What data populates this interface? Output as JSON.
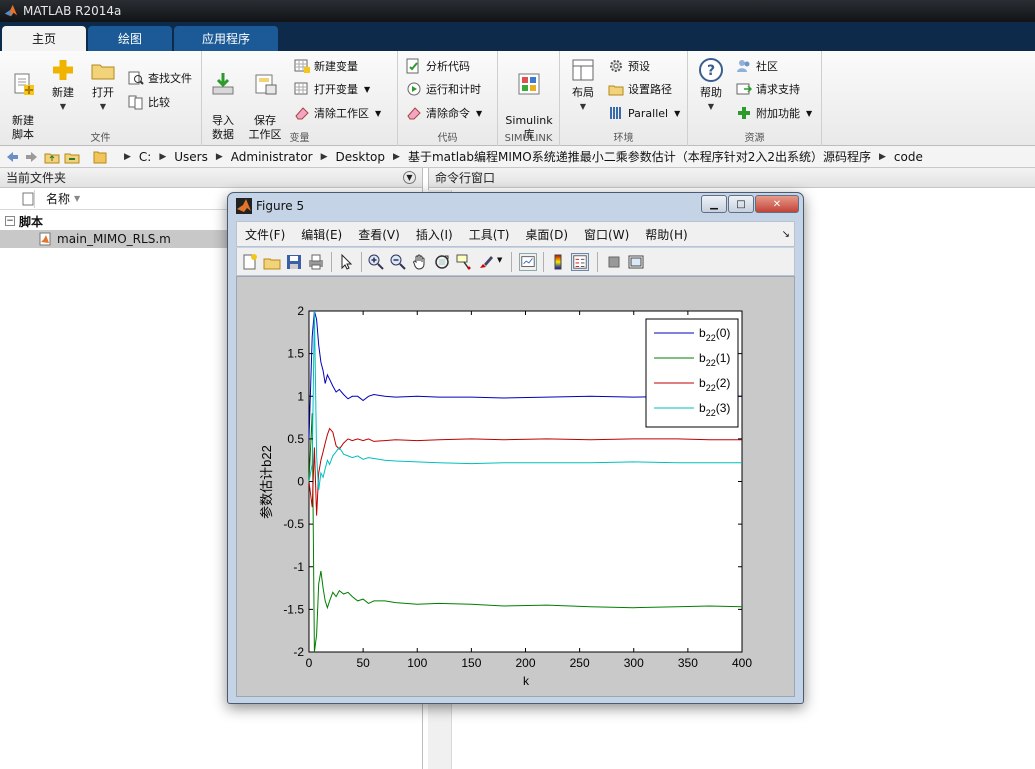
{
  "window": {
    "title": "MATLAB R2014a"
  },
  "tabs": [
    {
      "label": "主页",
      "active": true
    },
    {
      "label": "绘图",
      "active": false
    },
    {
      "label": "应用程序",
      "active": false
    }
  ],
  "ribbon": {
    "file": {
      "label": "文件",
      "new_script": "新建\n脚本",
      "new": "新建",
      "open": "打开",
      "find_files": "查找文件",
      "compare": "比较"
    },
    "variable": {
      "label": "变量",
      "import": "导入\n数据",
      "save_workspace": "保存\n工作区",
      "new_variable": "新建变量",
      "open_variable": "打开变量",
      "clear_workspace": "清除工作区"
    },
    "code": {
      "label": "代码",
      "analyze": "分析代码",
      "run_time": "运行和计时",
      "clear_commands": "清除命令"
    },
    "simulink": {
      "label": "SIMULINK",
      "library": "Simulink\n库"
    },
    "environment": {
      "label": "环境",
      "layout": "布局",
      "preferences": "预设",
      "set_path": "设置路径",
      "parallel": "Parallel"
    },
    "resources": {
      "label": "资源",
      "help": "帮助",
      "community": "社区",
      "request_support": "请求支持",
      "addons": "附加功能"
    }
  },
  "address": {
    "crumbs": [
      "C:",
      "Users",
      "Administrator",
      "Desktop",
      "基于matlab编程MIMO系统递推最小二乘参数估计（本程序针对2入2出系统）源码程序",
      "code"
    ]
  },
  "current_folder": {
    "title": "当前文件夹",
    "column_name": "名称",
    "group": "脚本",
    "files": [
      "main_MIMO_RLS.m"
    ]
  },
  "command_window": {
    "title": "命令行窗口"
  },
  "figure": {
    "title": "Figure 5",
    "menus": [
      "文件(F)",
      "编辑(E)",
      "查看(V)",
      "插入(I)",
      "工具(T)",
      "桌面(D)",
      "窗口(W)",
      "帮助(H)"
    ]
  },
  "chart_data": {
    "type": "line",
    "xlabel": "k",
    "ylabel": "参数估计b22",
    "xlim": [
      0,
      400
    ],
    "ylim": [
      -2,
      2
    ],
    "xticks": [
      0,
      50,
      100,
      150,
      200,
      250,
      300,
      350,
      400
    ],
    "yticks": [
      -2,
      -1.5,
      -1,
      -0.5,
      0,
      0.5,
      1,
      1.5,
      2
    ],
    "yticklabels": [
      "-2",
      "-1.5",
      "-1",
      "-0.5",
      "0",
      "0.5",
      "1",
      "1.5",
      "2"
    ],
    "legend_position": "top-right",
    "series": [
      {
        "name": "b22(0)",
        "label_main": "b",
        "label_sub": "22",
        "label_arg": "(0)",
        "color": "#0000bf",
        "x": [
          0,
          3,
          5,
          7,
          9,
          11,
          13,
          15,
          17,
          19,
          22,
          25,
          28,
          32,
          36,
          40,
          45,
          50,
          55,
          60,
          70,
          80,
          100,
          120,
          150,
          180,
          220,
          260,
          300,
          340,
          370,
          400
        ],
        "y": [
          0.5,
          1.7,
          2.0,
          1.9,
          1.6,
          1.4,
          1.3,
          1.15,
          1.25,
          1.2,
          1.12,
          1.05,
          1.08,
          1.02,
          0.97,
          1.0,
          1.0,
          0.95,
          1.0,
          1.02,
          1.0,
          0.99,
          1.0,
          0.99,
          0.99,
          0.98,
          0.99,
          1.0,
          0.99,
          1.0,
          1.0,
          1.0
        ]
      },
      {
        "name": "b22(1)",
        "label_main": "b",
        "label_sub": "22",
        "label_arg": "(1)",
        "color": "#007f00",
        "x": [
          0,
          3,
          5,
          7,
          9,
          11,
          13,
          15,
          17,
          19,
          22,
          25,
          28,
          32,
          36,
          40,
          45,
          50,
          55,
          60,
          70,
          80,
          100,
          120,
          150,
          180,
          220,
          260,
          300,
          340,
          370,
          400
        ],
        "y": [
          0,
          0.8,
          -2.0,
          -1.8,
          -1.2,
          -1.05,
          -1.25,
          -1.4,
          -1.48,
          -1.4,
          -1.3,
          -1.35,
          -1.28,
          -1.32,
          -1.3,
          -1.35,
          -1.4,
          -1.38,
          -1.43,
          -1.4,
          -1.4,
          -1.42,
          -1.44,
          -1.43,
          -1.44,
          -1.46,
          -1.45,
          -1.47,
          -1.48,
          -1.47,
          -1.46,
          -1.47
        ]
      },
      {
        "name": "b22(2)",
        "label_main": "b",
        "label_sub": "22",
        "label_arg": "(2)",
        "color": "#bf0000",
        "x": [
          0,
          3,
          5,
          7,
          9,
          11,
          13,
          15,
          17,
          19,
          22,
          25,
          28,
          32,
          36,
          40,
          45,
          50,
          55,
          60,
          70,
          80,
          100,
          120,
          150,
          180,
          220,
          260,
          300,
          340,
          370,
          400
        ],
        "y": [
          0,
          -0.3,
          0.4,
          -0.4,
          0.1,
          0.25,
          0.35,
          0.45,
          0.55,
          0.62,
          0.58,
          0.42,
          0.38,
          0.45,
          0.5,
          0.48,
          0.5,
          0.48,
          0.5,
          0.47,
          0.48,
          0.49,
          0.48,
          0.49,
          0.5,
          0.49,
          0.5,
          0.49,
          0.5,
          0.5,
          0.49,
          0.49
        ]
      },
      {
        "name": "b22(3)",
        "label_main": "b",
        "label_sub": "22",
        "label_arg": "(3)",
        "color": "#00bfbf",
        "x": [
          0,
          3,
          5,
          7,
          9,
          11,
          13,
          15,
          17,
          19,
          22,
          25,
          28,
          32,
          36,
          40,
          45,
          50,
          55,
          60,
          70,
          80,
          100,
          120,
          150,
          180,
          220,
          260,
          300,
          340,
          370,
          400
        ],
        "y": [
          0,
          0.2,
          2.0,
          0.3,
          -0.1,
          0.1,
          0.05,
          0.15,
          0.25,
          0.2,
          0.3,
          0.35,
          0.4,
          0.32,
          0.3,
          0.28,
          0.3,
          0.26,
          0.28,
          0.27,
          0.25,
          0.24,
          0.23,
          0.22,
          0.21,
          0.22,
          0.22,
          0.22,
          0.23,
          0.22,
          0.22,
          0.22
        ]
      }
    ]
  }
}
